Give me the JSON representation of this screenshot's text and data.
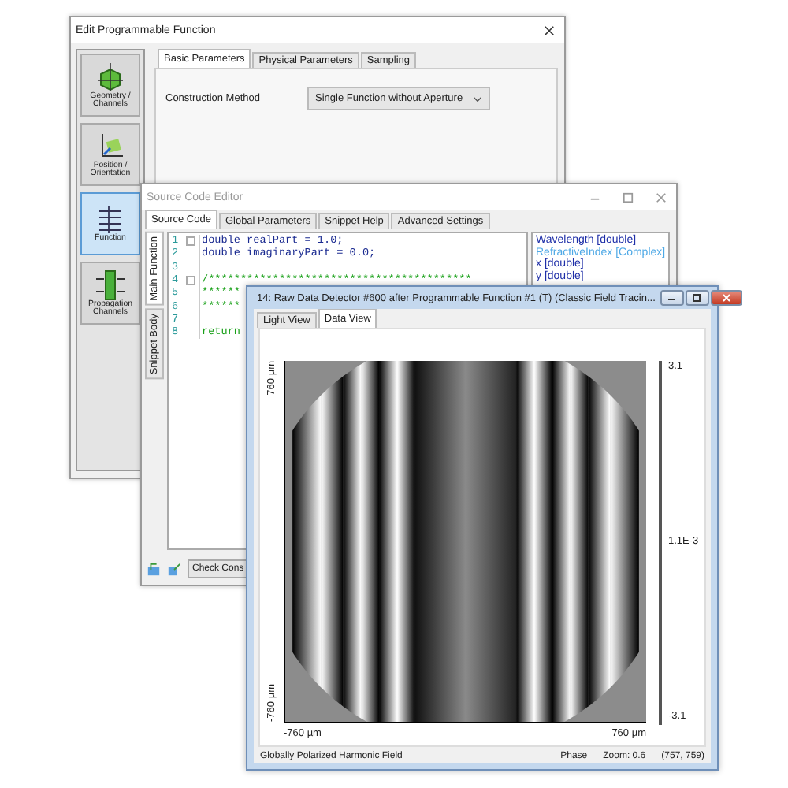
{
  "function_dialog": {
    "title": "Edit Programmable Function",
    "sidebar": [
      {
        "label": "Geometry / Channels",
        "kind": "geometry",
        "selected": false
      },
      {
        "label": "Position / Orientation",
        "kind": "position",
        "selected": false
      },
      {
        "label": "Function",
        "kind": "function",
        "selected": true
      },
      {
        "label": "Propagation Channels",
        "kind": "propagation",
        "selected": false
      }
    ],
    "tabs": [
      {
        "label": "Basic Parameters",
        "selected": true
      },
      {
        "label": "Physical Parameters",
        "selected": false
      },
      {
        "label": "Sampling",
        "selected": false
      }
    ],
    "construction_method": {
      "label": "Construction Method",
      "value": "Single Function without Aperture"
    }
  },
  "code_editor": {
    "title": "Source Code Editor",
    "tabs": [
      {
        "label": "Source Code",
        "selected": true
      },
      {
        "label": "Global Parameters",
        "selected": false
      },
      {
        "label": "Snippet Help",
        "selected": false
      },
      {
        "label": "Advanced Settings",
        "selected": false
      }
    ],
    "side_tabs": [
      {
        "label": "Main Function",
        "selected": true
      },
      {
        "label": "Snippet Body",
        "selected": false
      }
    ],
    "lines": [
      {
        "number": "1",
        "text": "double realPart = 1.0;",
        "fold_marker": true
      },
      {
        "number": "2",
        "text": "double imaginaryPart = 0.0;",
        "fold_marker": false
      },
      {
        "number": "3",
        "fold_marker": false
      },
      {
        "number": "4",
        "text": "/*****************************************",
        "fold_marker": true
      },
      {
        "number": "5",
        "text": "******",
        "fold_marker": false
      },
      {
        "number": "6",
        "text": "******",
        "fold_marker": false
      },
      {
        "number": "7",
        "fold_marker": false
      },
      {
        "number": "8",
        "text": "return",
        "fold_marker": false
      }
    ],
    "variables": [
      {
        "text": "Wavelength [double]",
        "color": "#1f2fa8"
      },
      {
        "text": "RefractiveIndex [Complex]",
        "color": "#4fa9e6"
      },
      {
        "text": "x [double]",
        "color": "#1f2fa8"
      },
      {
        "text": "y [double]",
        "color": "#1f2fa8"
      }
    ],
    "check_button": "Check Cons"
  },
  "detector_window": {
    "title": "14: Raw Data Detector #600 after Programmable Function #1 (T) (Classic Field Tracin...",
    "tabs": [
      {
        "label": "Light View",
        "selected": false
      },
      {
        "label": "Data View",
        "selected": true
      }
    ],
    "y_axis_top": "760 µm",
    "y_axis_bottom": "-760 µm",
    "x_axis_left": "-760 µm",
    "x_axis_right": "760 µm",
    "colorbar_labels": [
      "3.1",
      "1.1E-3",
      "-3.1"
    ],
    "status_left": "Globally Polarized Harmonic Field",
    "status_right": [
      "Phase",
      "Zoom: 0.6",
      "(757, 759)"
    ]
  }
}
